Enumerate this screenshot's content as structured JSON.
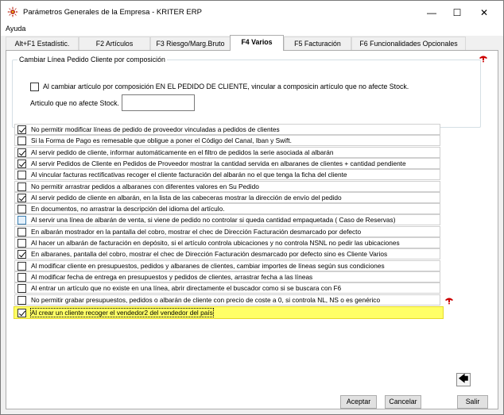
{
  "window": {
    "title": "Parámetros Generales de la Empresa - KRITER ERP",
    "controls": [
      "—",
      "☐",
      "✕"
    ]
  },
  "menu": {
    "items": [
      "Ayuda"
    ]
  },
  "tabs": [
    {
      "label": "Alt+F1 Estadístic."
    },
    {
      "label": "F2 Artículos"
    },
    {
      "label": "F3 Riesgo/Marg.Bruto"
    },
    {
      "label": "F4 Varios"
    },
    {
      "label": "F5 Facturación"
    },
    {
      "label": "F6 Funcionalidades Opcionales"
    }
  ],
  "active_tab": "F4 Varios",
  "group": {
    "legend": "Cambiar Línea Pedido Cliente por composición",
    "checkbox_label": "Al cambiar  artículo por composición EN EL PEDIDO DE CLIENTE, vincular a composicin artículo que no afecte Stock.",
    "checkbox_checked": false,
    "field_label": "Articulo que no afecte Stock.",
    "field_value": ""
  },
  "options": [
    {
      "label": "No permitir modificar líneas de pedido de proveedor vinculadas a pedidos de clientes",
      "checked": true
    },
    {
      "label": "Si la Forma de Pago es remesable que obligue a poner el Código del Canal, Iban y Swift.",
      "checked": false
    },
    {
      "label": "Al servir pedido de cliente, informar automáticamente en el filtro de pedidos la serie asociada al albarán",
      "checked": true
    },
    {
      "label": "Al servir Pedidos de Cliente en Pedidos de Proveedor mostrar la cantidad servida en albaranes de clientes + cantidad pendiente",
      "checked": true
    },
    {
      "label": "Al vincular facturas rectificativas recoger el cliente facturación del albarán no el que tenga la ficha del cliente",
      "checked": false
    },
    {
      "label": "No permitir arrastrar pedidos a albaranes con diferentes valores en Su Pedido",
      "checked": false
    },
    {
      "label": "Al servir pedido de cliente en albarán, en la lista de las cabeceras mostrar la dirección de envío del pedido",
      "checked": true
    },
    {
      "label": "En documentos, no arrastrar la descripción del idioma del artículo.",
      "checked": false
    },
    {
      "label": "Al servir una línea de albarán de venta, si viene de pedido no controlar si queda cantidad empaquetada ( Caso de Reservas)",
      "checked": false,
      "hover": true
    },
    {
      "label": "En albarán mostrador en la pantalla del cobro, mostrar el chec de Dirección Facturación desmarcado por defecto",
      "checked": false
    },
    {
      "label": "Al hacer un albarán de facturación en depósito, si el artículo controla ubicaciones y no controla NSNL no pedir las ubicaciones",
      "checked": false
    },
    {
      "label": "En albaranes, pantalla del cobro, mostrar el chec de Dirección Facturación desmarcado por defecto sino es Cliente Varios",
      "checked": true
    },
    {
      "label": "Al modificar cliente en presupuestos, pedidos y albaranes de clientes, cambiar importes de líneas según sus condiciones",
      "checked": false
    },
    {
      "label": "Al modificar fecha de entrega en presupuestos y pedidos de clientes, arrastrar fecha a las líneas",
      "checked": false
    },
    {
      "label": "Al entrar un artículo que no existe en una línea, abrir directamente el buscador como si se buscara con F6",
      "checked": false
    },
    {
      "label": "No permitir grabar presupuestos, pedidos o albarán de cliente con precio de coste a 0, si controla NL, NS o es genérico",
      "checked": false
    },
    {
      "label": "Al crear un cliente recoger el vendedor2 del vendedor del país",
      "checked": true,
      "highlight": true
    }
  ],
  "buttons": {
    "back_icon": "🡄",
    "accept": "Aceptar",
    "cancel": "Cancelar",
    "exit": "Salir"
  },
  "colors": {
    "highlight": "#ffff66",
    "help_icon": "#cc0000"
  }
}
